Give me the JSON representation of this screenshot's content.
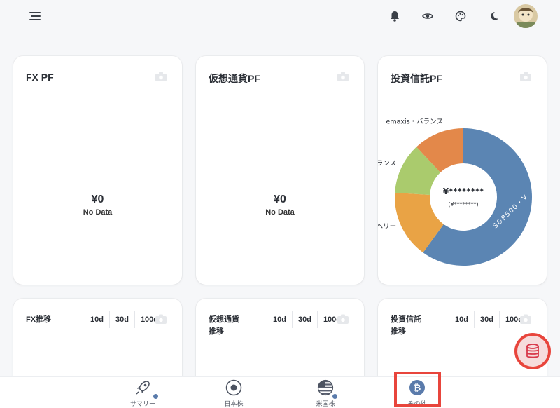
{
  "topbar": {
    "menu_icon": "hamburger-menu-icon",
    "icons": [
      "bell-icon",
      "eye-icon",
      "palette-icon",
      "moon-icon"
    ],
    "avatar": "user-avatar"
  },
  "cards": [
    {
      "title": "FX PF",
      "value": "¥0",
      "sub": "No Data"
    },
    {
      "title": "仮想通貨PF",
      "value": "¥0",
      "sub": "No Data"
    },
    {
      "title": "投資信託PF",
      "value": "¥********",
      "sub": "(¥********)"
    }
  ],
  "trend_cards": [
    {
      "title_line1": "FX推移",
      "title_line2": ""
    },
    {
      "title_line1": "仮想通貨",
      "title_line2": "推移"
    },
    {
      "title_line1": "投資信託",
      "title_line2": "推移"
    }
  ],
  "ranges": [
    "10d",
    "30d",
    "100d"
  ],
  "chart_data": {
    "type": "pie",
    "donut": true,
    "categories": [
      "S&P500・V",
      "ヘリー",
      "バランス",
      "emaxis・バランス"
    ],
    "values": [
      60,
      16,
      12,
      12
    ],
    "colors": [
      "#5b85b3",
      "#e9a345",
      "#aacb6d",
      "#e3884a"
    ],
    "center_text": "¥********",
    "center_sub": "(¥********)"
  },
  "bottom_nav": [
    {
      "label": "サマリー",
      "icon": "rocket-icon",
      "dot": true
    },
    {
      "label": "日本株",
      "icon": "japan-flag-icon",
      "dot": false
    },
    {
      "label": "米国株",
      "icon": "us-flag-icon",
      "dot": true
    },
    {
      "label": "その他",
      "icon": "bitcoin-icon",
      "dot": false
    }
  ],
  "fab": {
    "icon": "database-icon"
  },
  "colors": {
    "accent_red": "#e8453c",
    "nav_blue": "#5a7bab"
  }
}
